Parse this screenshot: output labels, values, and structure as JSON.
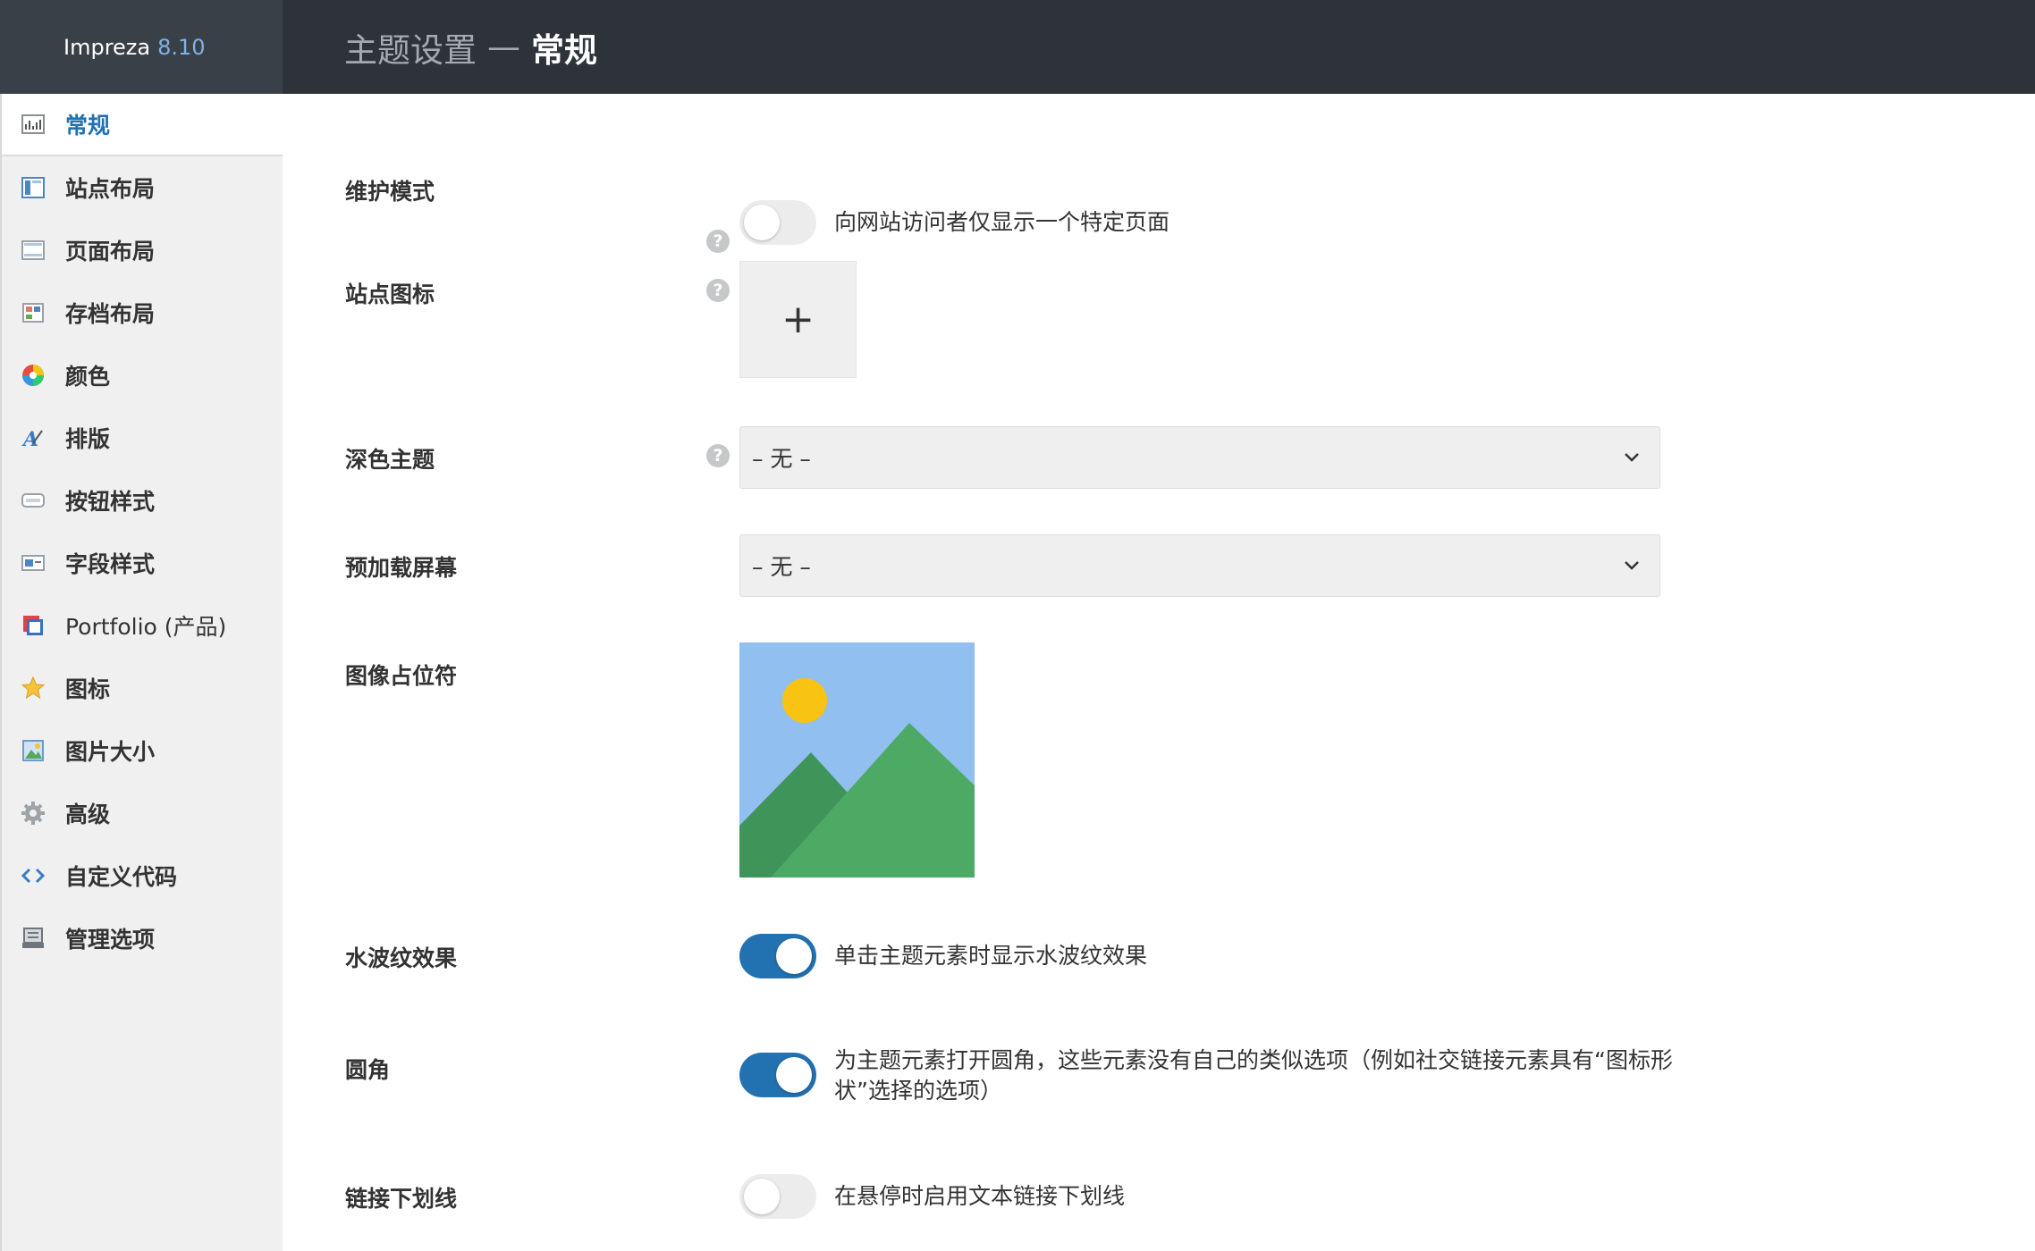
{
  "header": {
    "app_name": "Impreza",
    "version": "8.10",
    "title_prefix": "主题设置",
    "title_separator": "—",
    "title_section": "常规"
  },
  "sidebar": {
    "items": [
      {
        "label": "常规",
        "icon": "general-settings-icon",
        "active": true
      },
      {
        "label": "站点布局",
        "icon": "site-layout-icon"
      },
      {
        "label": "页面布局",
        "icon": "page-layout-icon"
      },
      {
        "label": "存档布局",
        "icon": "archive-layout-icon"
      },
      {
        "label": "颜色",
        "icon": "color-wheel-icon"
      },
      {
        "label": "排版",
        "icon": "typography-icon"
      },
      {
        "label": "按钮样式",
        "icon": "button-style-icon"
      },
      {
        "label": "字段样式",
        "icon": "field-style-icon"
      },
      {
        "label": "Portfolio (产品)",
        "icon": "portfolio-icon"
      },
      {
        "label": "图标",
        "icon": "star-icon"
      },
      {
        "label": "图片大小",
        "icon": "image-size-icon"
      },
      {
        "label": "高级",
        "icon": "gear-icon"
      },
      {
        "label": "自定义代码",
        "icon": "code-icon"
      },
      {
        "label": "管理选项",
        "icon": "manage-options-icon"
      }
    ]
  },
  "settings": {
    "maintenance": {
      "label": "维护模式",
      "description": "向网站访问者仅显示一个特定页面",
      "enabled": false
    },
    "site_icon": {
      "label": "站点图标",
      "upload_symbol": "+"
    },
    "dark_theme": {
      "label": "深色主题",
      "value": "– 无 –"
    },
    "preloader": {
      "label": "预加载屏幕",
      "value": "– 无 –"
    },
    "image_placeholder": {
      "label": "图像占位符"
    },
    "ripple": {
      "label": "水波纹效果",
      "description": "单击主题元素时显示水波纹效果",
      "enabled": true
    },
    "rounded": {
      "label": "圆角",
      "description_line1": "为主题元素打开圆角，这些元素没有自己的类似选项（例如社交链接元素具有“图标形",
      "description_line2": "状”选择的选项）",
      "enabled": true
    },
    "link_underline": {
      "label": "链接下划线",
      "description": "在悬停时启用文本链接下划线",
      "enabled": false
    }
  },
  "help_symbol": "?",
  "colors": {
    "accent": "#2271b1",
    "topbar": "#2d3339",
    "sidebar": "#f0f0f1"
  }
}
